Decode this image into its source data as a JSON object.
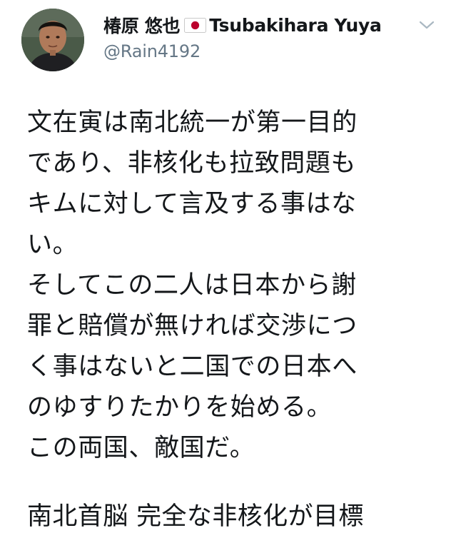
{
  "author": {
    "name": "椿原 悠也",
    "flag_icon": "japan-flag-icon",
    "name_latin": "Tsubakihara Yuya",
    "handle": "@Rain4192",
    "avatar_icon": "user-avatar"
  },
  "menu": {
    "icon": "chevron-down-icon"
  },
  "tweet": {
    "lines": [
      "文在寅は南北統一が第一目的",
      "であり、非核化も拉致問題も",
      "キムに対して言及する事はな",
      "い。",
      "そしてこの二人は日本から謝",
      "罪と賠償が無ければ交渉につ",
      "く事はないと二国での日本へ",
      "のゆすりたかりを始める。",
      "この両国、敵国だ。"
    ]
  },
  "quoted": {
    "headline": "南北首脳 完全な非核化が目標"
  },
  "colors": {
    "text": "#14171a",
    "secondary": "#657786",
    "flag_red": "#bc002d"
  }
}
